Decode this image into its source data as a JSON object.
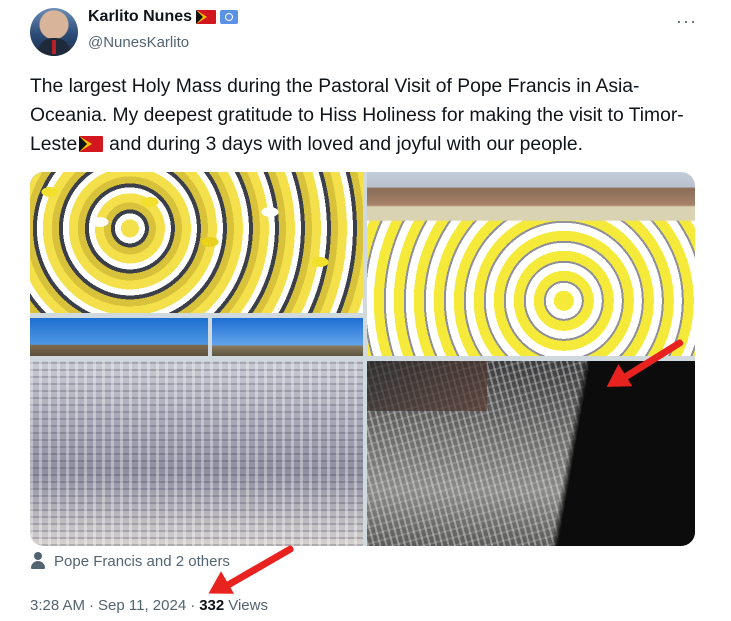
{
  "author": {
    "display_name": "Karlito Nunes",
    "handle": "@NunesKarlito"
  },
  "menu": {
    "more_label": "···"
  },
  "tweet": {
    "text_part1": "The largest Holy Mass during the Pastoral Visit of Pope Francis in Asia-Oceania. My deepest gratitude to Hiss Holiness for making the visit to Timor-Leste",
    "text_part2": "and during 3 days with loved and joyful with our people."
  },
  "tagged": {
    "label": "Pope Francis and 2 others"
  },
  "meta": {
    "time": "3:28 AM",
    "separator1": "·",
    "date": "Sep 11, 2024",
    "separator2": "·",
    "views_count": "332",
    "views_label": "Views"
  },
  "colors": {
    "accent_red": "#e8221e",
    "muted": "#536471",
    "text": "#0f1419"
  },
  "icons": [
    "flag-timor-leste-icon",
    "un-flag-icon",
    "more-options-icon",
    "person-icon",
    "red-arrow-icon"
  ]
}
